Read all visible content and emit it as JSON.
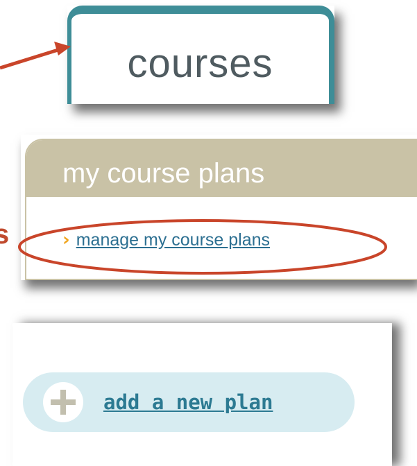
{
  "courses_tab": {
    "label": "courses"
  },
  "course_plans": {
    "title": "my course plans",
    "link_label": "manage my course plans",
    "chevron_icon": "chevron-right"
  },
  "add_plan": {
    "label": "add a new plan",
    "plus_icon": "plus-circle"
  },
  "annotation": {
    "color": "#c9452a",
    "edge_letter": "s"
  },
  "colors": {
    "tab_teal": "#3e8d97",
    "header_tan": "#c9c2a6",
    "link_blue": "#2c6f91",
    "pill_blue": "#d7ecf1",
    "chevron_orange": "#f0a51e"
  }
}
